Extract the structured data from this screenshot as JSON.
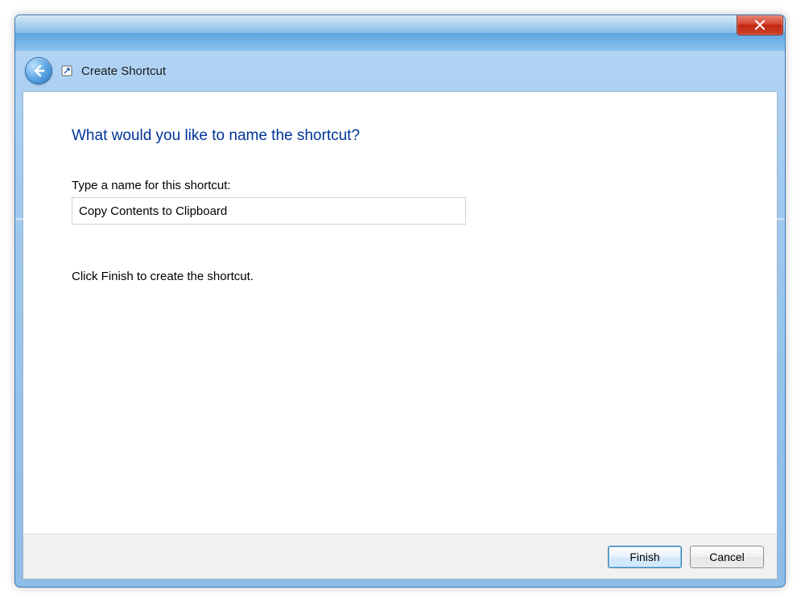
{
  "window": {
    "title": "Create Shortcut"
  },
  "content": {
    "heading": "What would you like to name the shortcut?",
    "field_label": "Type a name for this shortcut:",
    "shortcut_name": "Copy Contents to Clipboard",
    "instruction": "Click Finish to create the shortcut."
  },
  "footer": {
    "finish": "Finish",
    "cancel": "Cancel"
  }
}
